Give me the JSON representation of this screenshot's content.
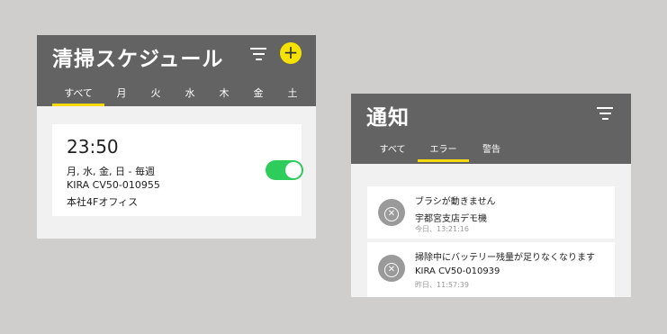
{
  "schedule": {
    "title": "清掃スケジュール",
    "add_icon": "plus-icon",
    "filter_icon": "filter-icon",
    "tabs": [
      "すべて",
      "月",
      "火",
      "水",
      "木",
      "金",
      "土"
    ],
    "active_tab": "すべて",
    "item": {
      "time": "23:50",
      "days": "月, 水, 金, 日 - 毎週",
      "device": "KIRA CV50-010955",
      "location": "本社4Fオフィス",
      "enabled": true
    }
  },
  "notifications": {
    "title": "通知",
    "filter_icon": "filter-icon",
    "tabs": [
      "すべて",
      "エラー",
      "警告"
    ],
    "active_tab": "エラー",
    "items": [
      {
        "message": "ブラシが動きません",
        "device": "宇都宮支店デモ機",
        "time": "今日、13:21:16",
        "icon": "error-icon"
      },
      {
        "message": "掃除中にバッテリー残量が足りなくなります",
        "device": "KIRA CV50-010939",
        "time": "昨日、11:57:39",
        "icon": "error-icon"
      }
    ]
  },
  "colors": {
    "header": "#636363",
    "accent": "#f5d90a",
    "add_button": "#f5e200",
    "toggle_on": "#2ecc5a",
    "background": "#cfcecc"
  }
}
